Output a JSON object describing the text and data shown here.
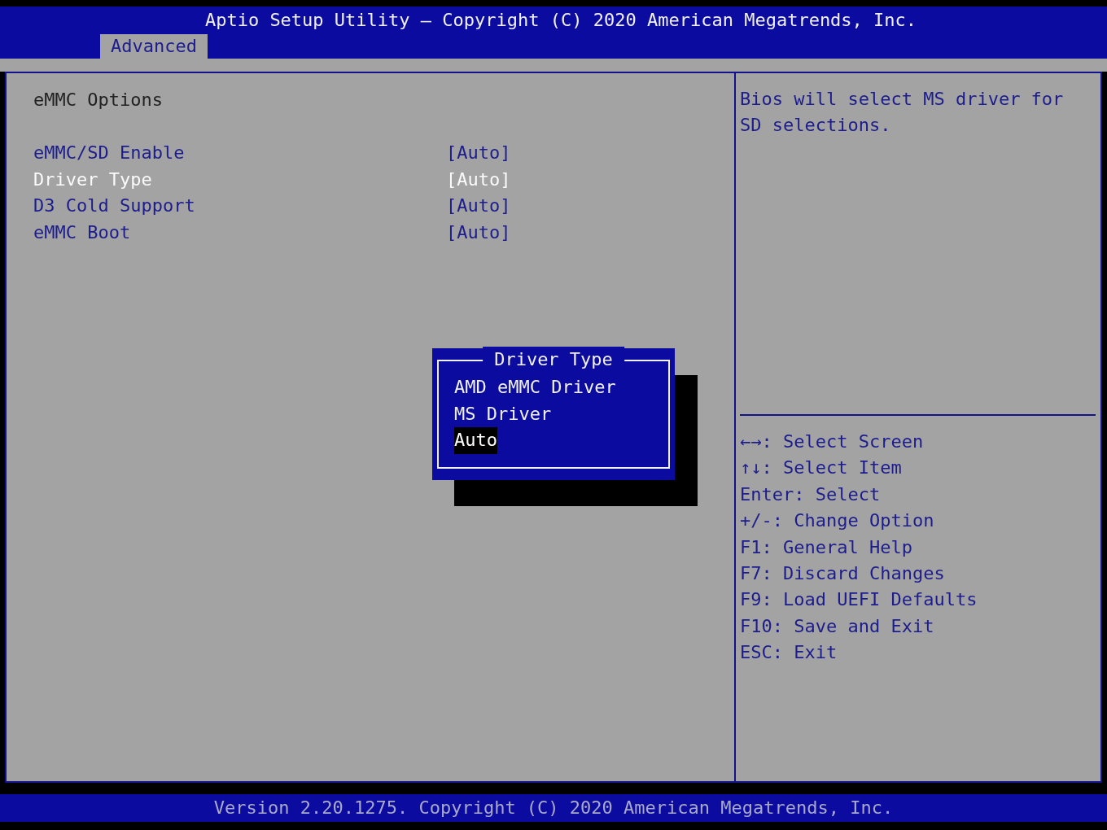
{
  "header": {
    "title": "Aptio Setup Utility – Copyright (C) 2020 American Megatrends, Inc."
  },
  "tabs": [
    {
      "label": "Advanced",
      "selected": true
    }
  ],
  "page_title": "eMMC Options",
  "settings": [
    {
      "label": "eMMC/SD Enable",
      "value": "[Auto]",
      "selected": false
    },
    {
      "label": "Driver Type",
      "value": "[Auto]",
      "selected": true
    },
    {
      "label": "D3 Cold Support",
      "value": "[Auto]",
      "selected": false
    },
    {
      "label": "eMMC Boot",
      "value": "[Auto]",
      "selected": false
    }
  ],
  "popup": {
    "title": "Driver Type",
    "options": [
      {
        "label": "AMD eMMC Driver",
        "selected": false
      },
      {
        "label": "MS Driver",
        "selected": false
      },
      {
        "label": "Auto",
        "selected": true
      }
    ]
  },
  "help_text": "Bios will select MS driver for SD selections.",
  "key_help": [
    "←→: Select Screen",
    "↑↓: Select Item",
    "Enter: Select",
    "+/-: Change Option",
    "F1: General Help",
    "F7: Discard Changes",
    "F9: Load UEFI Defaults",
    "F10: Save and Exit",
    "ESC: Exit"
  ],
  "footer": "Version 2.20.1275. Copyright (C) 2020 American Megatrends, Inc."
}
